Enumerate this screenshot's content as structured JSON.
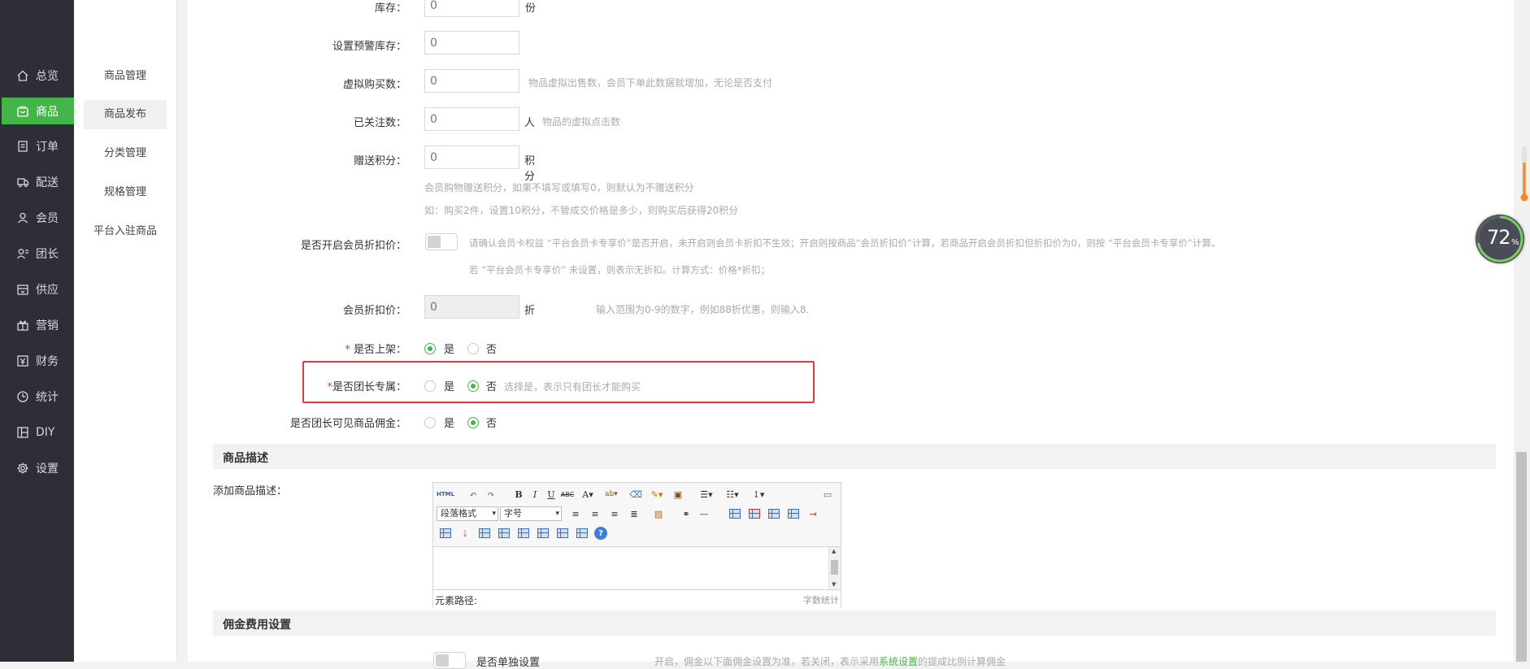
{
  "sidebar": {
    "items": [
      {
        "label": "总览",
        "icon": "home-icon"
      },
      {
        "label": "商品",
        "icon": "goods-icon",
        "active": true
      },
      {
        "label": "订单",
        "icon": "order-icon"
      },
      {
        "label": "配送",
        "icon": "delivery-icon"
      },
      {
        "label": "会员",
        "icon": "member-icon"
      },
      {
        "label": "团长",
        "icon": "leader-icon"
      },
      {
        "label": "供应",
        "icon": "supply-icon"
      },
      {
        "label": "营销",
        "icon": "gift-icon"
      },
      {
        "label": "财务",
        "icon": "finance-icon"
      },
      {
        "label": "统计",
        "icon": "stats-icon"
      },
      {
        "label": "DIY",
        "icon": "diy-icon"
      },
      {
        "label": "设置",
        "icon": "gear-icon"
      }
    ],
    "accent": "#44b549"
  },
  "submenu": {
    "items": [
      "商品管理",
      "商品发布",
      "分类管理",
      "规格管理",
      "平台入驻商品"
    ]
  },
  "form": {
    "stock": {
      "label": "库存：",
      "value": "0",
      "unit": "份"
    },
    "warn_stock": {
      "label": "设置预警库存：",
      "value": "0"
    },
    "virtual_sales": {
      "label": "虚拟购买数：",
      "value": "0",
      "hint": "物品虚拟出售数，会员下单此数据就增加，无论是否支付"
    },
    "followers": {
      "label": "已关注数：",
      "value": "0",
      "unit": "人",
      "hint": "物品的虚拟点击数"
    },
    "points": {
      "label": "赠送积分：",
      "value": "0",
      "unit": "积分",
      "hint1": "会员购物赠送积分，如果不填写或填写0，则默认为不赠送积分",
      "hint2": "如：购买2件，设置10积分，不管成交价格是多少，则购买后获得20积分"
    },
    "member_discount_switch": {
      "label": "是否开启会员折扣价：",
      "hint1": "请确认会员卡权益 “平台会员卡专享价”是否开启，未开启则会员卡折扣不生效；开启则按商品“会员折扣价”计算，若商品开启会员折扣但折扣价为0，则按 “平台会员卡专享价”计算。",
      "hint2": "若 “平台会员卡专享价” 未设置，则表示无折扣。计算方式：价格*折扣；"
    },
    "member_discount": {
      "label": "会员折扣价：",
      "value": "0",
      "unit": "折",
      "hint": "输入范围为0-9的数字，例如88折优惠，则输入8."
    },
    "on_shelf": {
      "req": "*",
      "label": "是否上架：",
      "yes": "是",
      "no": "否"
    },
    "leader_only": {
      "req": "*",
      "label": "是否团长专属：",
      "yes": "是",
      "no": "否",
      "hint": "选择是，表示只有团长才能购买"
    },
    "leader_commission": {
      "label": "是否团长可见商品佣金：",
      "yes": "是",
      "no": "否"
    }
  },
  "desc_section": {
    "title": "商品描述",
    "label": "添加商品描述：",
    "editor": {
      "html_btn": "HTML",
      "paragraph_select": "段落格式",
      "fontsize_select": "字号",
      "path_label": "元素路径:",
      "count_label": "字数统计"
    }
  },
  "commission_section": {
    "title": "佣金费用设置",
    "switch_label": "是否单独设置",
    "hint_pre": "开启，佣金以下面佣金设置为准，若关闭，表示采用",
    "hint_link": "系统设置",
    "hint_post": "的提成比例计算佣金"
  },
  "perf": {
    "value": "72",
    "unit": "%"
  }
}
